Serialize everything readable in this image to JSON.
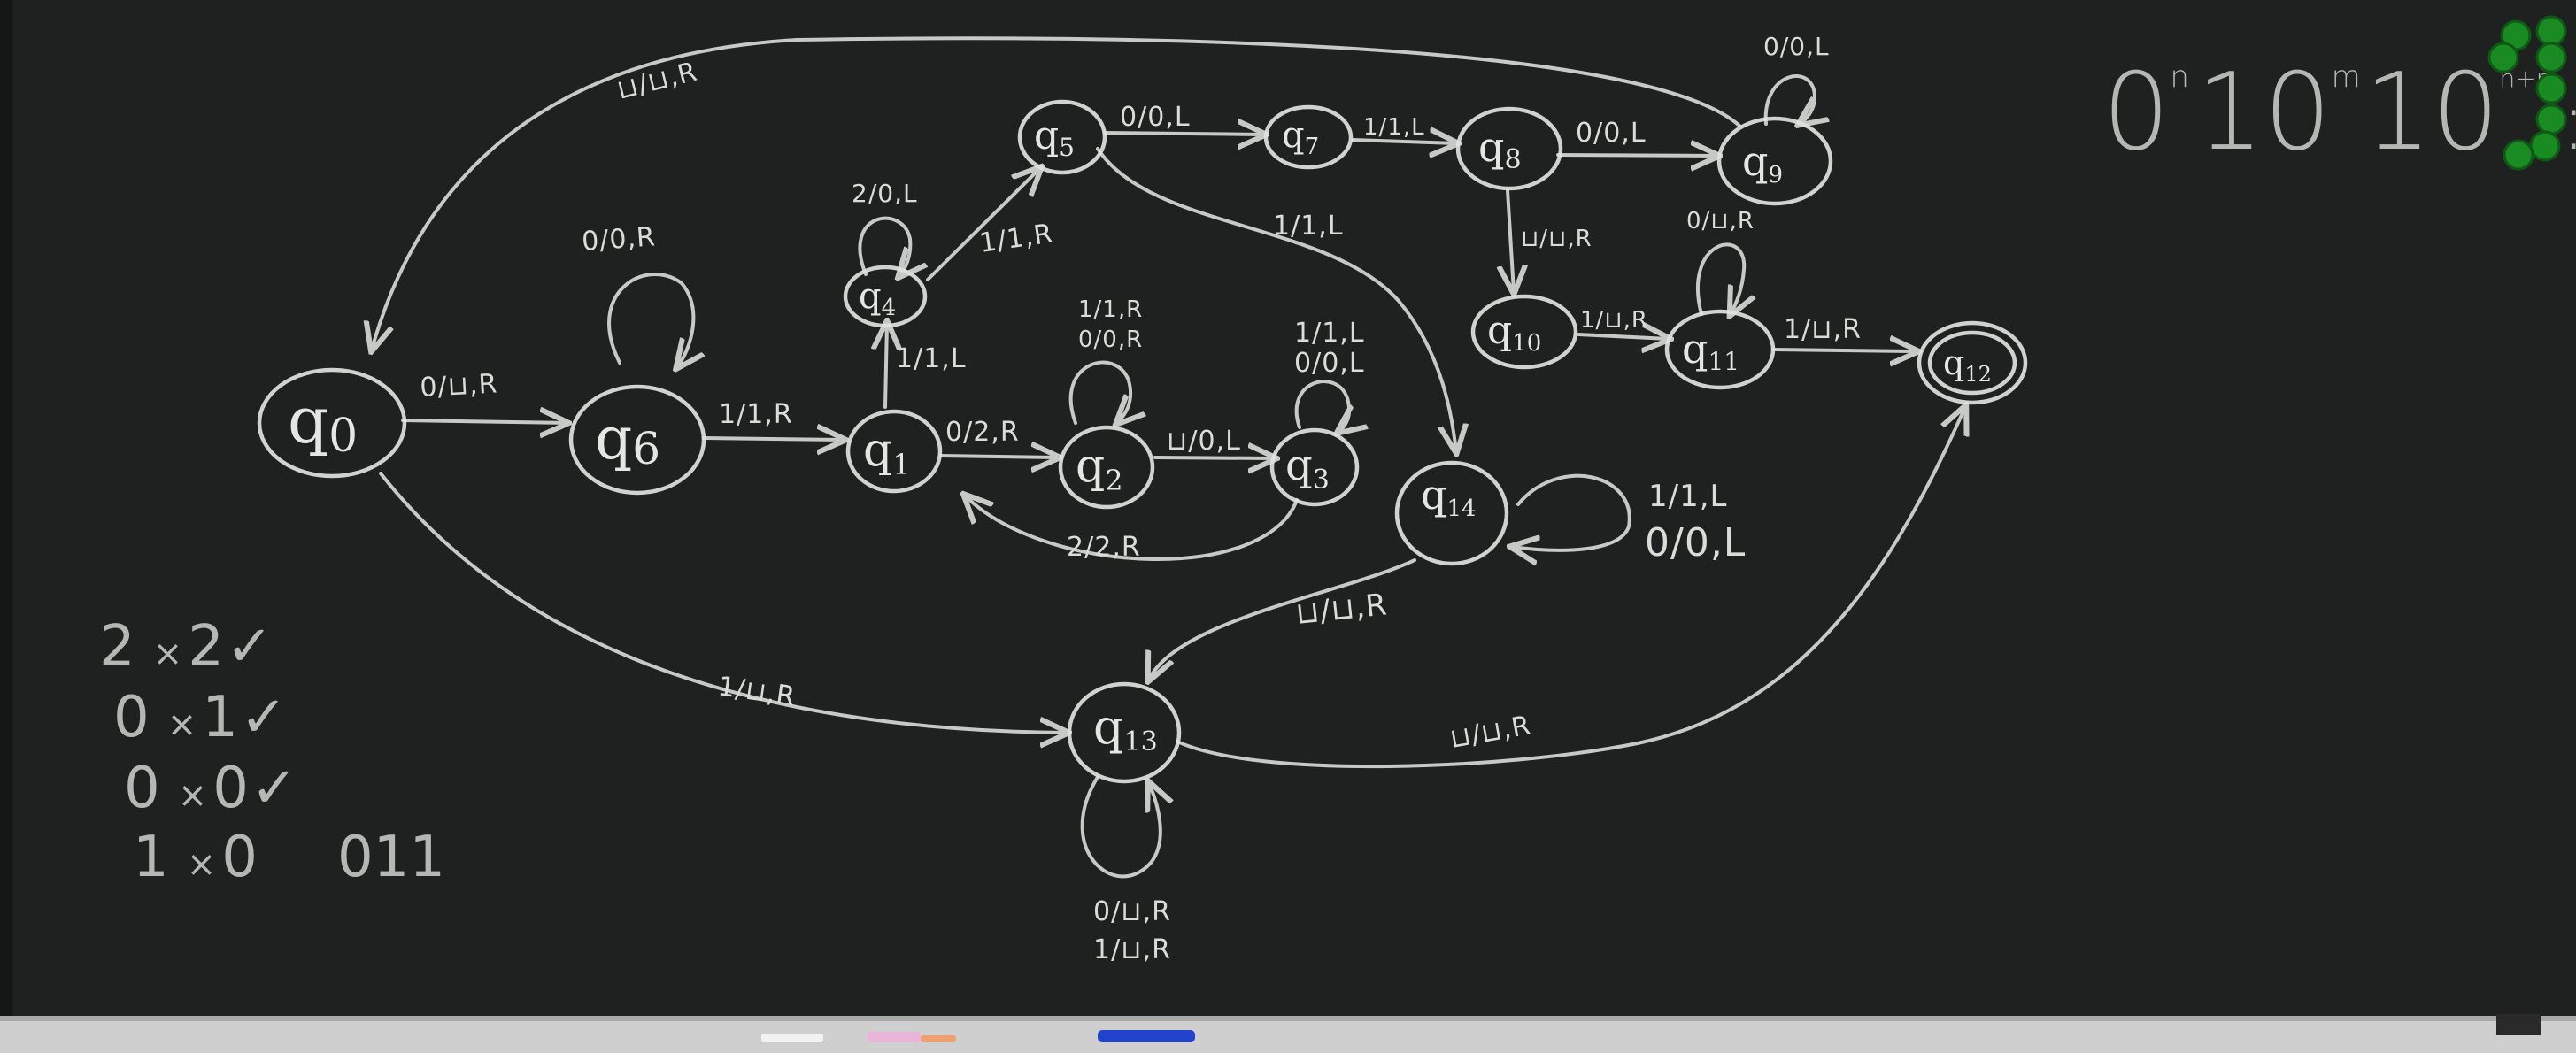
{
  "states": [
    {
      "id": "q0",
      "name": "q",
      "sub": "0"
    },
    {
      "id": "q1",
      "name": "q",
      "sub": "1"
    },
    {
      "id": "q2",
      "name": "q",
      "sub": "2"
    },
    {
      "id": "q3",
      "name": "q",
      "sub": "3"
    },
    {
      "id": "q4",
      "name": "q",
      "sub": "4"
    },
    {
      "id": "q5",
      "name": "q",
      "sub": "5"
    },
    {
      "id": "q6",
      "name": "q",
      "sub": "6"
    },
    {
      "id": "q7",
      "name": "q",
      "sub": "7"
    },
    {
      "id": "q8",
      "name": "q",
      "sub": "8"
    },
    {
      "id": "q9",
      "name": "q",
      "sub": "9"
    },
    {
      "id": "q10",
      "name": "q",
      "sub": "10"
    },
    {
      "id": "q11",
      "name": "q",
      "sub": "11"
    },
    {
      "id": "q12",
      "name": "q",
      "sub": "12",
      "accepting": true
    },
    {
      "id": "q13",
      "name": "q",
      "sub": "13"
    },
    {
      "id": "q14",
      "name": "q",
      "sub": "14"
    }
  ],
  "transitions": [
    {
      "from": "q0",
      "to": "q6",
      "label": "0/⊔,R"
    },
    {
      "from": "q6",
      "to": "q6",
      "label": "0/0,R"
    },
    {
      "from": "q6",
      "to": "q1",
      "label": "1/1,R"
    },
    {
      "from": "q1",
      "to": "q2",
      "label": "0/2,R"
    },
    {
      "from": "q1",
      "to": "q4",
      "label": "1/1,L"
    },
    {
      "from": "q2",
      "to": "q2",
      "label": "1/1,R"
    },
    {
      "from": "q2",
      "to": "q2",
      "label": "0/0,R"
    },
    {
      "from": "q2",
      "to": "q3",
      "label": "⊔/0,L"
    },
    {
      "from": "q3",
      "to": "q3",
      "label": "1/1,L"
    },
    {
      "from": "q3",
      "to": "q3",
      "label": "0/0,L"
    },
    {
      "from": "q3",
      "to": "q1",
      "label": "2/2,R"
    },
    {
      "from": "q4",
      "to": "q4",
      "label": "2/0,L"
    },
    {
      "from": "q4",
      "to": "q5",
      "label": "1/1,R"
    },
    {
      "from": "q5",
      "to": "q7",
      "label": "0/0,L"
    },
    {
      "from": "q5",
      "to": "q14",
      "label": "1/1,L"
    },
    {
      "from": "q7",
      "to": "q8",
      "label": "1/1,L"
    },
    {
      "from": "q8",
      "to": "q9",
      "label": "0/0,L"
    },
    {
      "from": "q9",
      "to": "q9",
      "label": "0/0,L"
    },
    {
      "from": "q9",
      "to": "q0",
      "label": "⊔/⊔,R"
    },
    {
      "from": "q8",
      "to": "q10",
      "label": "⊔/⊔,R"
    },
    {
      "from": "q10",
      "to": "q11",
      "label": "1/⊔,R"
    },
    {
      "from": "q11",
      "to": "q11",
      "label": "0/⊔,R"
    },
    {
      "from": "q11",
      "to": "q12",
      "label": "1/⊔,R"
    },
    {
      "from": "q14",
      "to": "q14",
      "label": "1/1,L"
    },
    {
      "from": "q14",
      "to": "q14",
      "label": "0/0,L"
    },
    {
      "from": "q14",
      "to": "q13",
      "label": "⊔/⊔,R"
    },
    {
      "from": "q0",
      "to": "q13",
      "label": "1/⊔,R"
    },
    {
      "from": "q13",
      "to": "q13",
      "label": "0/⊔,R"
    },
    {
      "from": "q13",
      "to": "q13",
      "label": "1/⊔,R"
    },
    {
      "from": "q13",
      "to": "q12",
      "label": "⊔/⊔,R"
    }
  ],
  "language": {
    "d1": "0",
    "e1": "n",
    "d2": "1",
    "d3": "0",
    "e3": "m",
    "d4": "1",
    "d5": "0",
    "e5": "n+m",
    "punct": ":"
  },
  "examples": [
    {
      "left": "2",
      "op": "×",
      "right": "2",
      "mark": "✓"
    },
    {
      "left": "0",
      "op": "×",
      "right": "1",
      "mark": "✓"
    },
    {
      "left": "0",
      "op": "×",
      "right": "0",
      "mark": "✓"
    },
    {
      "left": "1",
      "op": "×",
      "right": "0",
      "result": "011"
    }
  ],
  "colors": {
    "board": "#1e2120",
    "chalk": "#d9dcd8",
    "magnet": "#1a8a22"
  }
}
